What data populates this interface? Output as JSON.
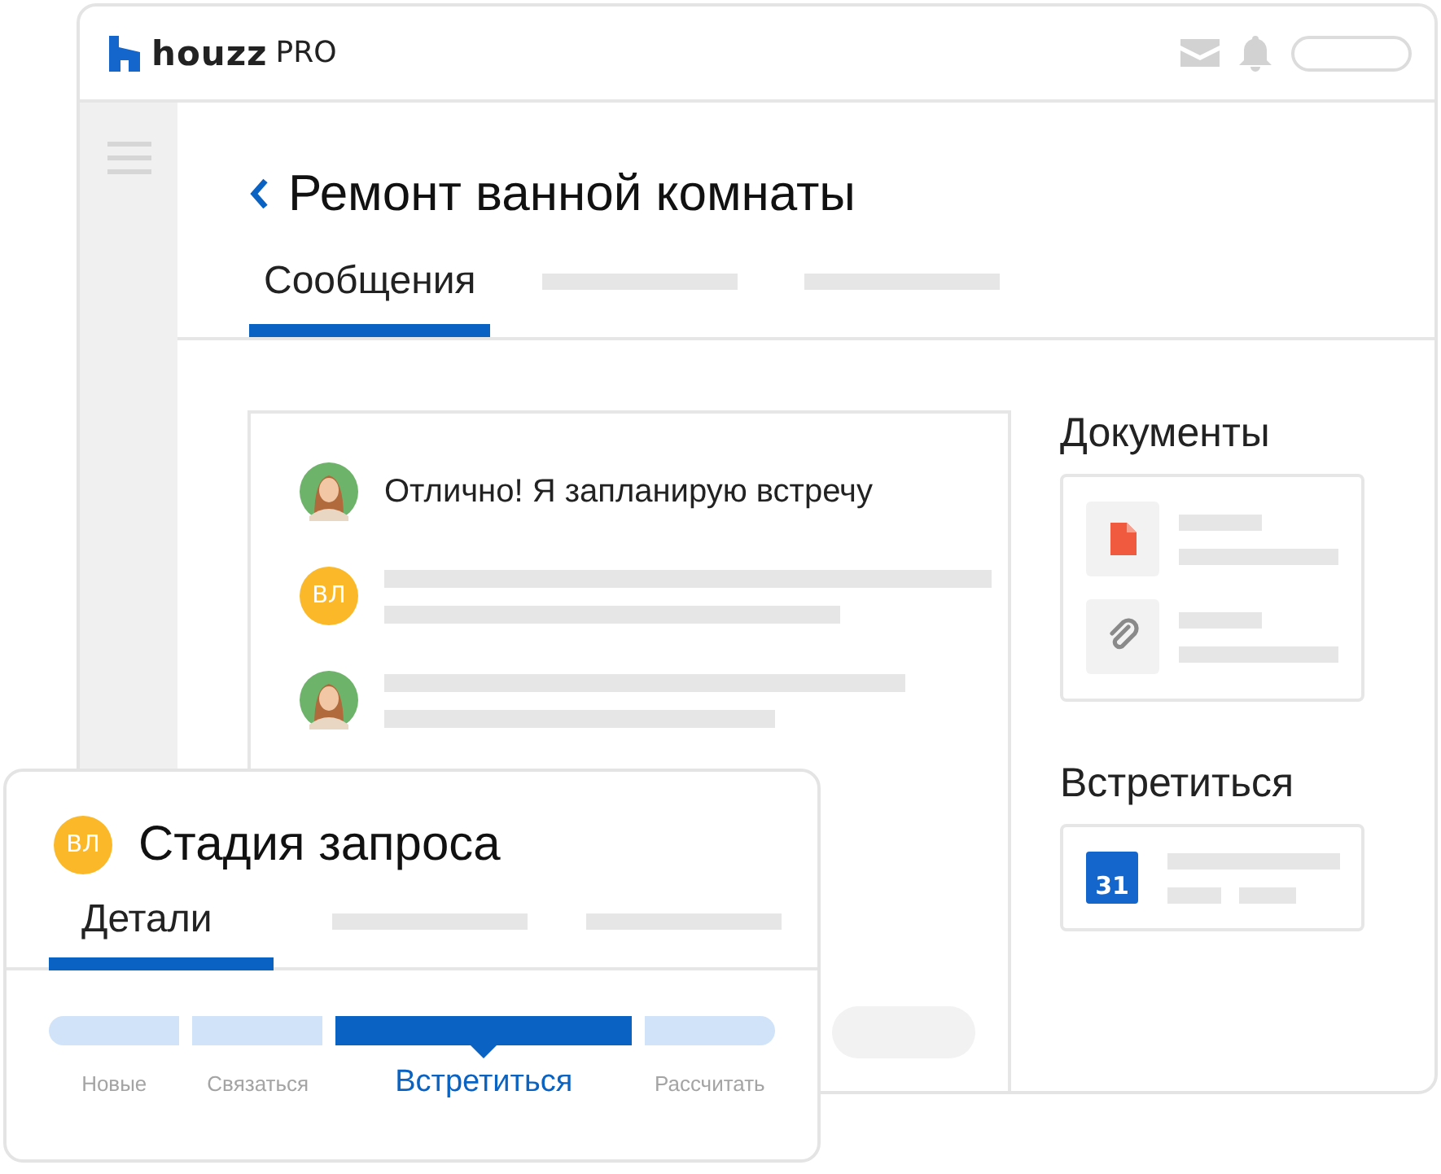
{
  "app": {
    "logo": "houzz",
    "logo_suffix": "PRO"
  },
  "project": {
    "title": "Ремонт ванной комнаты"
  },
  "tabs": [
    {
      "label": "Сообщения",
      "selected": true
    }
  ],
  "messages": [
    {
      "kind": "text",
      "text": "Отлично! Я запланирую встречу"
    },
    {
      "kind": "placeholder",
      "avatar": {
        "kind": "initials",
        "initials": "ВЛ"
      }
    },
    {
      "kind": "placeholder"
    }
  ],
  "documents": {
    "title": "Документы",
    "items": [
      {
        "kind": "file"
      },
      {
        "kind": "attachment"
      }
    ]
  },
  "meeting": {
    "title": "Встретиться",
    "calendar_day": "31"
  },
  "stage_card": {
    "initials": "ВЛ",
    "title": "Стадия запроса",
    "tabs": [
      {
        "label": "Детали",
        "selected": true
      }
    ],
    "stages": [
      {
        "label": "Новые",
        "selected": false
      },
      {
        "label": "Связаться",
        "selected": false
      },
      {
        "label": "Встретиться",
        "selected": true
      },
      {
        "label": "Рассчитать",
        "selected": false
      }
    ]
  }
}
